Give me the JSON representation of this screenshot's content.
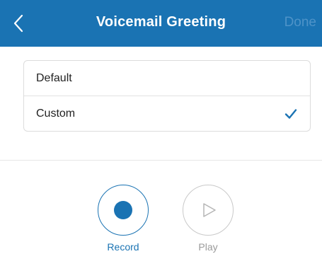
{
  "header": {
    "title": "Voicemail Greeting",
    "done_label": "Done",
    "back_icon": "chevron-left-icon"
  },
  "greeting_options": {
    "items": [
      {
        "label": "Default",
        "selected": false
      },
      {
        "label": "Custom",
        "selected": true
      }
    ],
    "check_icon": "checkmark-icon"
  },
  "controls": {
    "record_label": "Record",
    "play_label": "Play"
  },
  "colors": {
    "primary": "#1a73b3",
    "done_disabled": "#4e93c8",
    "disabled_gray": "#9a9a9a"
  }
}
